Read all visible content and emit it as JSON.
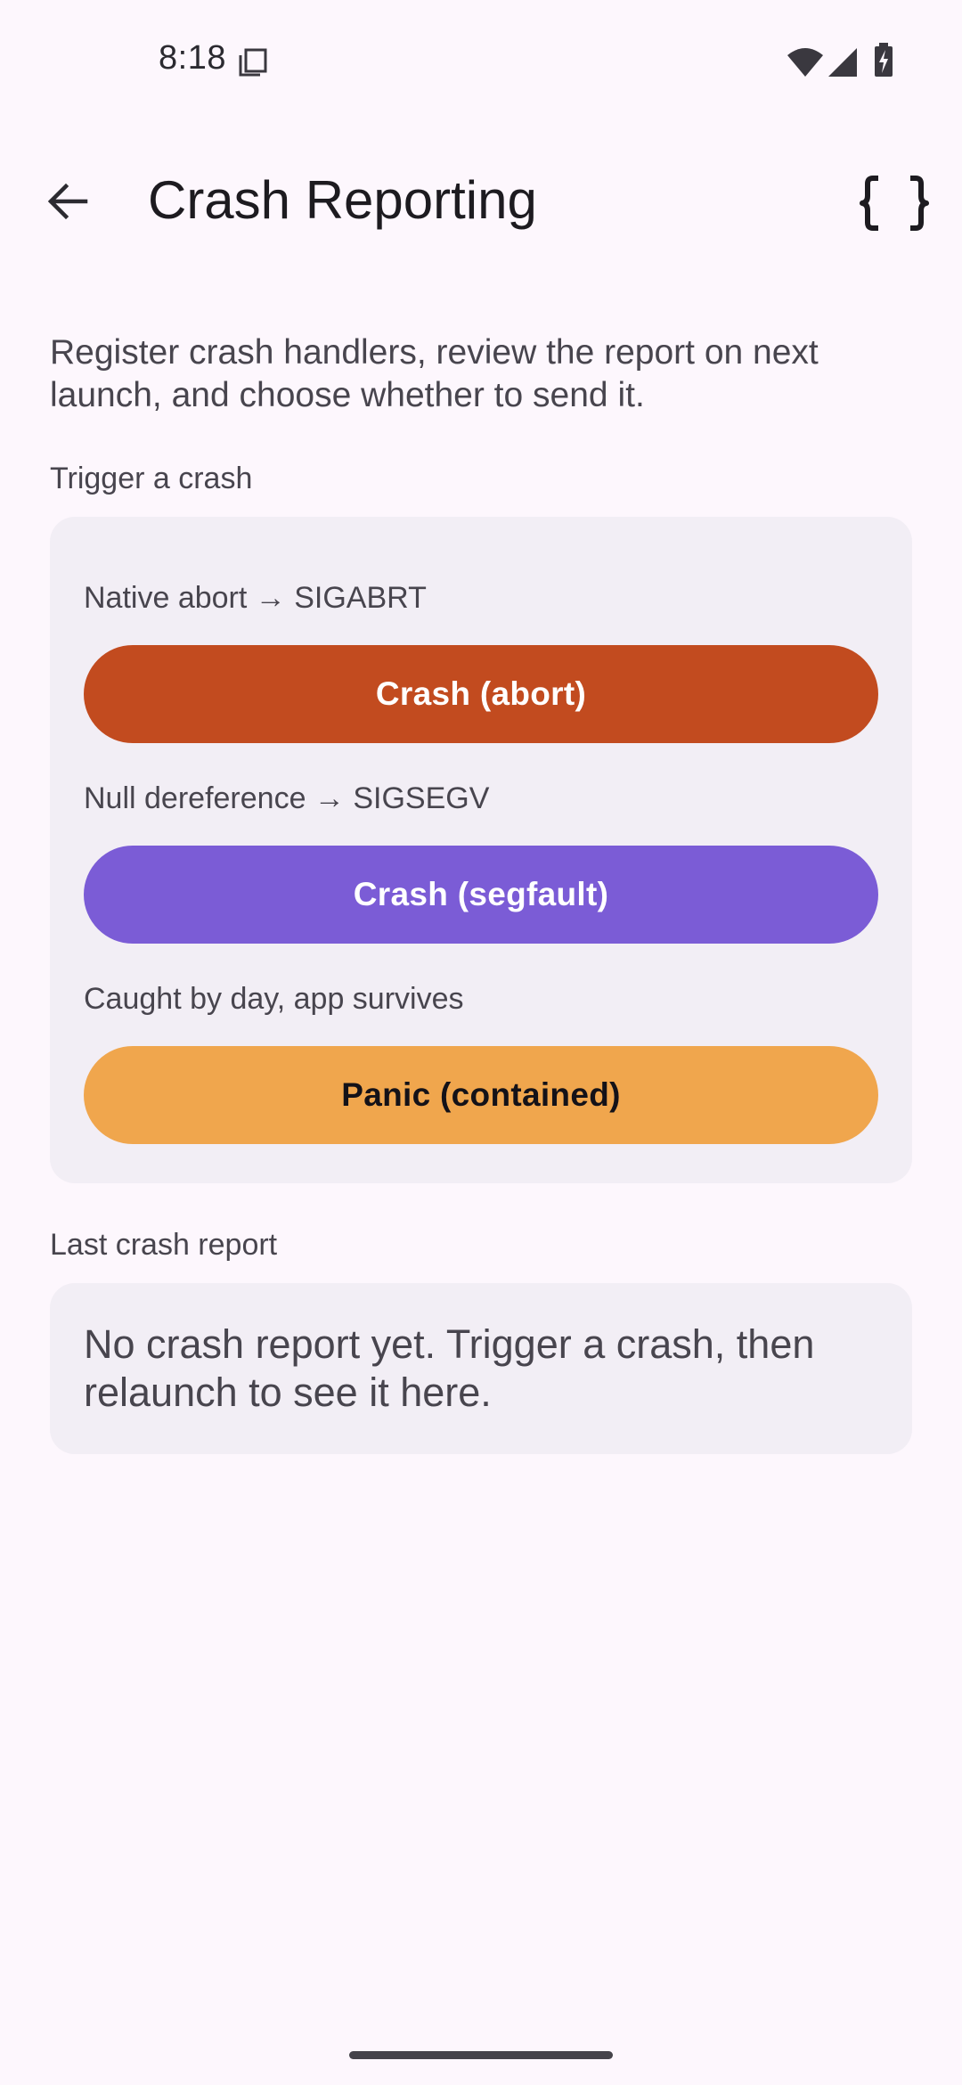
{
  "status_bar": {
    "time": "8:18",
    "icons": [
      "copy-icon",
      "wifi-icon",
      "signal-icon",
      "battery-charging-icon"
    ]
  },
  "app_bar": {
    "back_icon": "arrow-left-icon",
    "title": "Crash Reporting",
    "action_icon": "curly-braces-icon"
  },
  "intro": {
    "description": "Register crash handlers, review the report on next launch, and choose whether to send it."
  },
  "trigger_section": {
    "label": "Trigger a crash",
    "items": [
      {
        "caption": "Native abort → SIGABRT",
        "button_label": "Crash (abort)",
        "color": "#c24b1f"
      },
      {
        "caption": "Null dereference → SIGSEGV",
        "button_label": "Crash (segfault)",
        "color": "#7b5cd6"
      },
      {
        "caption": "Caught by day, app survives",
        "button_label": "Panic (contained)",
        "color": "#f0a64d"
      }
    ]
  },
  "report_section": {
    "label": "Last crash report",
    "empty_text": "No crash report yet. Trigger a crash, then relaunch to see it here."
  },
  "colors": {
    "background": "#fdf7fd",
    "card": "#f2eef5",
    "text_primary": "#1d1b20",
    "text_secondary": "#48454e"
  }
}
